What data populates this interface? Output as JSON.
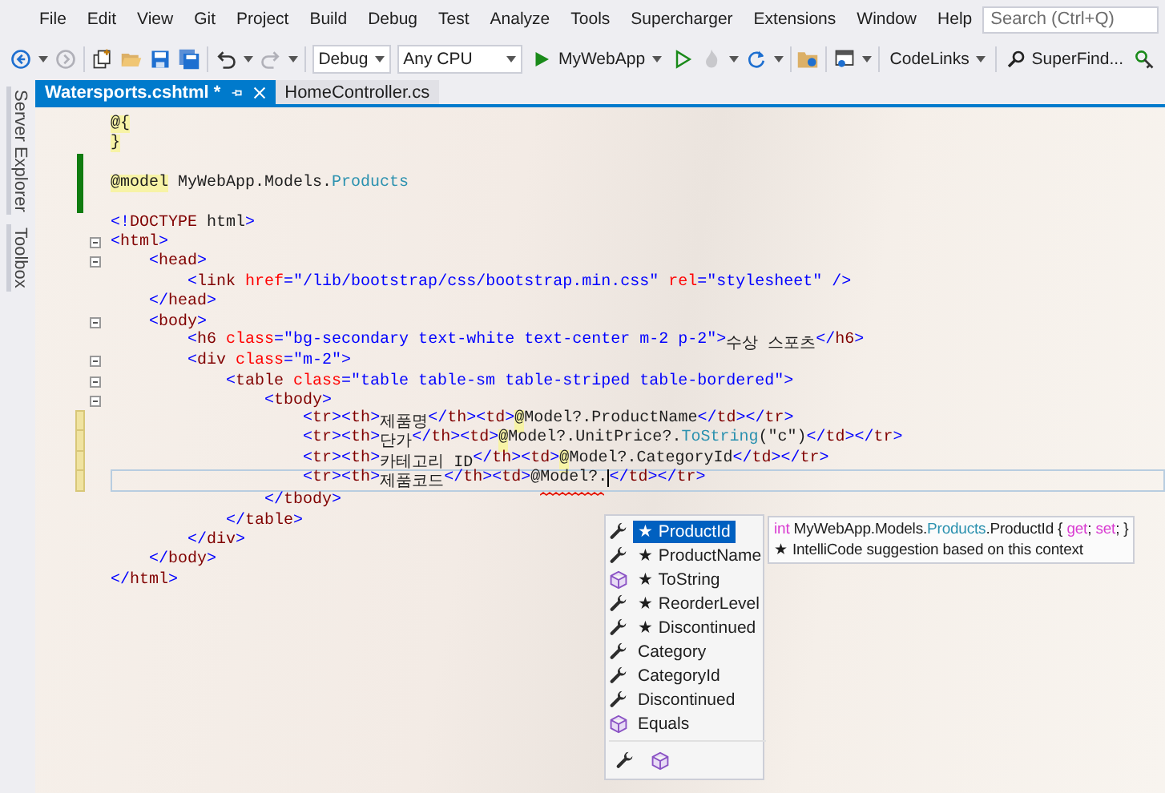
{
  "menu": {
    "items": [
      "File",
      "Edit",
      "View",
      "Git",
      "Project",
      "Build",
      "Debug",
      "Test",
      "Analyze",
      "Tools",
      "Supercharger",
      "Extensions",
      "Window",
      "Help"
    ],
    "search": {
      "placeholder": "Search (Ctrl+Q)"
    }
  },
  "toolbar": {
    "configuration": "Debug",
    "platform": "Any CPU",
    "run_target": "MyWebApp",
    "codelinks": "CodeLinks",
    "superfind": "SuperFind..."
  },
  "side_tabs": [
    "Server Explorer",
    "Toolbox"
  ],
  "tabs": [
    {
      "label": "Watersports.cshtml *",
      "selected": true
    },
    {
      "label": "HomeController.cs",
      "selected": false
    }
  ],
  "editor": {
    "lines": [
      {
        "segments": [
          {
            "text": "@{",
            "kind": "razor"
          }
        ]
      },
      {
        "segments": [
          {
            "text": "}",
            "kind": "razor"
          }
        ]
      },
      {
        "modified": true,
        "saved": true
      },
      {
        "segments": [
          {
            "text": "@model",
            "kind": "razor"
          },
          {
            "text": " MyWebApp.Models.",
            "kind": "text"
          },
          {
            "text": "Products",
            "kind": "type"
          }
        ],
        "modified": true,
        "saved": true
      },
      {
        "modified": true,
        "saved": true
      },
      {
        "segments": [
          {
            "text": "<!",
            "kind": "delim"
          },
          {
            "text": "DOCTYPE",
            "kind": "tag"
          },
          {
            "text": " html",
            "kind": "text"
          },
          {
            "text": ">",
            "kind": "delim"
          }
        ]
      },
      {
        "segments": [
          {
            "text": "<",
            "kind": "delim"
          },
          {
            "text": "html",
            "kind": "tag"
          },
          {
            "text": ">",
            "kind": "delim"
          }
        ],
        "collapsible": true,
        "children": [
          {
            "segments": [
              {
                "text": "<",
                "kind": "delim"
              },
              {
                "text": "head",
                "kind": "tag"
              },
              {
                "text": ">",
                "kind": "delim"
              }
            ],
            "collapsible": true,
            "children": [
              {
                "segments": [
                  {
                    "text": "<",
                    "kind": "delim"
                  },
                  {
                    "text": "link",
                    "kind": "tag"
                  },
                  {
                    "text": " href",
                    "kind": "attr"
                  },
                  {
                    "text": "=\"/lib/bootstrap/css/bootstrap.min.css\"",
                    "kind": "value"
                  },
                  {
                    "text": " rel",
                    "kind": "attr"
                  },
                  {
                    "text": "=\"stylesheet\" />",
                    "kind": "value"
                  }
                ]
              }
            ]
          },
          {
            "segments": [
              {
                "text": "</",
                "kind": "delim"
              },
              {
                "text": "head",
                "kind": "tag"
              },
              {
                "text": ">",
                "kind": "delim"
              }
            ]
          },
          {
            "segments": [
              {
                "text": "<",
                "kind": "delim"
              },
              {
                "text": "body",
                "kind": "tag"
              },
              {
                "text": ">",
                "kind": "delim"
              }
            ],
            "collapsible": true,
            "children": [
              {
                "segments": [
                  {
                    "text": "<",
                    "kind": "delim"
                  },
                  {
                    "text": "h6",
                    "kind": "tag"
                  },
                  {
                    "text": " class",
                    "kind": "attr"
                  },
                  {
                    "text": "=\"bg-secondary text-white text-center m-2 p-2\">",
                    "kind": "value"
                  },
                  {
                    "text": "수상 스포츠",
                    "kind": "text"
                  },
                  {
                    "text": "</",
                    "kind": "delim"
                  },
                  {
                    "text": "h6",
                    "kind": "tag"
                  },
                  {
                    "text": ">",
                    "kind": "delim"
                  }
                ]
              },
              {
                "segments": [
                  {
                    "text": "<",
                    "kind": "delim"
                  },
                  {
                    "text": "div",
                    "kind": "tag"
                  },
                  {
                    "text": " class",
                    "kind": "attr"
                  },
                  {
                    "text": "=\"m-2\">",
                    "kind": "value"
                  }
                ],
                "collapsible": true,
                "children": [
                  {
                    "segments": [
                      {
                        "text": "<",
                        "kind": "delim"
                      },
                      {
                        "text": "table",
                        "kind": "tag"
                      },
                      {
                        "text": " class",
                        "kind": "attr"
                      },
                      {
                        "text": "=\"table table-sm table-striped table-bordered\">",
                        "kind": "value"
                      }
                    ],
                    "collapsible": true,
                    "children": [
                      {
                        "segments": [
                          {
                            "text": "<",
                            "kind": "delim"
                          },
                          {
                            "text": "tbody",
                            "kind": "tag"
                          },
                          {
                            "text": ">",
                            "kind": "delim"
                          }
                        ],
                        "collapsible": true,
                        "children": [
                          {
                            "segments": [
                              {
                                "text": "<",
                                "kind": "delim"
                              },
                              {
                                "text": "tr",
                                "kind": "tag"
                              },
                              {
                                "text": "><",
                                "kind": "delim"
                              },
                              {
                                "text": "th",
                                "kind": "tag"
                              },
                              {
                                "text": ">",
                                "kind": "delim"
                              },
                              {
                                "text": "제품명",
                                "kind": "text"
                              },
                              {
                                "text": "</",
                                "kind": "delim"
                              },
                              {
                                "text": "th",
                                "kind": "tag"
                              },
                              {
                                "text": "><",
                                "kind": "delim"
                              },
                              {
                                "text": "td",
                                "kind": "tag"
                              },
                              {
                                "text": ">",
                                "kind": "delim"
                              },
                              {
                                "text": "@",
                                "kind": "razor"
                              },
                              {
                                "text": "Model?.ProductName",
                                "kind": "text"
                              },
                              {
                                "text": "</",
                                "kind": "delim"
                              },
                              {
                                "text": "td",
                                "kind": "tag"
                              },
                              {
                                "text": "></",
                                "kind": "delim"
                              },
                              {
                                "text": "tr",
                                "kind": "tag"
                              },
                              {
                                "text": ">",
                                "kind": "delim"
                              }
                            ],
                            "modified": true,
                            "saved": false
                          },
                          {
                            "segments": [
                              {
                                "text": "<",
                                "kind": "delim"
                              },
                              {
                                "text": "tr",
                                "kind": "tag"
                              },
                              {
                                "text": "><",
                                "kind": "delim"
                              },
                              {
                                "text": "th",
                                "kind": "tag"
                              },
                              {
                                "text": ">",
                                "kind": "delim"
                              },
                              {
                                "text": "단가",
                                "kind": "text"
                              },
                              {
                                "text": "</",
                                "kind": "delim"
                              },
                              {
                                "text": "th",
                                "kind": "tag"
                              },
                              {
                                "text": "><",
                                "kind": "delim"
                              },
                              {
                                "text": "td",
                                "kind": "tag"
                              },
                              {
                                "text": ">",
                                "kind": "delim"
                              },
                              {
                                "text": "@",
                                "kind": "razor"
                              },
                              {
                                "text": "Model?.UnitPrice?.",
                                "kind": "text"
                              },
                              {
                                "text": "ToString",
                                "kind": "method"
                              },
                              {
                                "text": "(\"c\")",
                                "kind": "text"
                              },
                              {
                                "text": "</",
                                "kind": "delim"
                              },
                              {
                                "text": "td",
                                "kind": "tag"
                              },
                              {
                                "text": "></",
                                "kind": "delim"
                              },
                              {
                                "text": "tr",
                                "kind": "tag"
                              },
                              {
                                "text": ">",
                                "kind": "delim"
                              }
                            ],
                            "modified": true,
                            "saved": false
                          },
                          {
                            "segments": [
                              {
                                "text": "<",
                                "kind": "delim"
                              },
                              {
                                "text": "tr",
                                "kind": "tag"
                              },
                              {
                                "text": "><",
                                "kind": "delim"
                              },
                              {
                                "text": "th",
                                "kind": "tag"
                              },
                              {
                                "text": ">",
                                "kind": "delim"
                              },
                              {
                                "text": "카테고리 ID",
                                "kind": "text"
                              },
                              {
                                "text": "</",
                                "kind": "delim"
                              },
                              {
                                "text": "th",
                                "kind": "tag"
                              },
                              {
                                "text": "><",
                                "kind": "delim"
                              },
                              {
                                "text": "td",
                                "kind": "tag"
                              },
                              {
                                "text": ">",
                                "kind": "delim"
                              },
                              {
                                "text": "@",
                                "kind": "razor"
                              },
                              {
                                "text": "Model?.CategoryId",
                                "kind": "text"
                              },
                              {
                                "text": "</",
                                "kind": "delim"
                              },
                              {
                                "text": "td",
                                "kind": "tag"
                              },
                              {
                                "text": "></",
                                "kind": "delim"
                              },
                              {
                                "text": "tr",
                                "kind": "tag"
                              },
                              {
                                "text": ">",
                                "kind": "delim"
                              }
                            ],
                            "modified": true,
                            "saved": false
                          },
                          {
                            "segments": [
                              {
                                "text": "<",
                                "kind": "delim"
                              },
                              {
                                "text": "tr",
                                "kind": "tag"
                              },
                              {
                                "text": "><",
                                "kind": "delim"
                              },
                              {
                                "text": "th",
                                "kind": "tag"
                              },
                              {
                                "text": ">",
                                "kind": "delim"
                              },
                              {
                                "text": "제품코드",
                                "kind": "text"
                              },
                              {
                                "text": "</",
                                "kind": "delim"
                              },
                              {
                                "text": "th",
                                "kind": "tag"
                              },
                              {
                                "text": "><",
                                "kind": "delim"
                              },
                              {
                                "text": "td",
                                "kind": "tag"
                              },
                              {
                                "text": ">",
                                "kind": "delim"
                              },
                              {
                                "text": "@",
                                "kind": "razor"
                              },
                              {
                                "text": "Model?.",
                                "kind": "text",
                                "squiggle": true,
                                "caret": true
                              },
                              {
                                "text": "</",
                                "kind": "delim"
                              },
                              {
                                "text": "td",
                                "kind": "tag"
                              },
                              {
                                "text": "></",
                                "kind": "delim"
                              },
                              {
                                "text": "tr",
                                "kind": "tag"
                              },
                              {
                                "text": ">",
                                "kind": "delim"
                              }
                            ],
                            "modified": true,
                            "saved": false,
                            "current": true
                          }
                        ]
                      },
                      {
                        "segments": [
                          {
                            "text": "</",
                            "kind": "delim"
                          },
                          {
                            "text": "tbody",
                            "kind": "tag"
                          },
                          {
                            "text": ">",
                            "kind": "delim"
                          }
                        ]
                      }
                    ]
                  },
                  {
                    "segments": [
                      {
                        "text": "</",
                        "kind": "delim"
                      },
                      {
                        "text": "table",
                        "kind": "tag"
                      },
                      {
                        "text": ">",
                        "kind": "delim"
                      }
                    ]
                  }
                ]
              },
              {
                "segments": [
                  {
                    "text": "</",
                    "kind": "delim"
                  },
                  {
                    "text": "div",
                    "kind": "tag"
                  },
                  {
                    "text": ">",
                    "kind": "delim"
                  }
                ]
              }
            ]
          },
          {
            "segments": [
              {
                "text": "</",
                "kind": "delim"
              },
              {
                "text": "body",
                "kind": "tag"
              },
              {
                "text": ">",
                "kind": "delim"
              }
            ]
          }
        ]
      },
      {
        "segments": [
          {
            "text": "</",
            "kind": "delim"
          },
          {
            "text": "html",
            "kind": "tag"
          },
          {
            "text": ">",
            "kind": "delim"
          }
        ]
      }
    ]
  },
  "completion": {
    "items": [
      {
        "label": "★ ProductId",
        "kind": "property",
        "selected": true
      },
      {
        "label": "★ ProductName",
        "kind": "property",
        "selected": false
      },
      {
        "label": "★ ToString",
        "kind": "method",
        "selected": false
      },
      {
        "label": "★ ReorderLevel",
        "kind": "property",
        "selected": false
      },
      {
        "label": "★ Discontinued",
        "kind": "property",
        "selected": false
      },
      {
        "label": "Category",
        "kind": "property",
        "selected": false
      },
      {
        "label": "CategoryId",
        "kind": "property",
        "selected": false
      },
      {
        "label": "Discontinued",
        "kind": "property",
        "selected": false
      },
      {
        "label": "Equals",
        "kind": "method",
        "selected": false
      }
    ],
    "filters": [
      {
        "kind": "property"
      },
      {
        "kind": "method"
      }
    ],
    "tooltip": {
      "signature": [
        {
          "text": "int",
          "kind": "keyword"
        },
        {
          "text": " MyWebApp.Models.",
          "kind": "text"
        },
        {
          "text": "Products",
          "kind": "type"
        },
        {
          "text": ".ProductId { ",
          "kind": "text"
        },
        {
          "text": "get",
          "kind": "keyword"
        },
        {
          "text": "; ",
          "kind": "text"
        },
        {
          "text": "set",
          "kind": "keyword"
        },
        {
          "text": "; }",
          "kind": "text"
        }
      ],
      "note": "★ IntelliCode suggestion based on this context"
    }
  }
}
